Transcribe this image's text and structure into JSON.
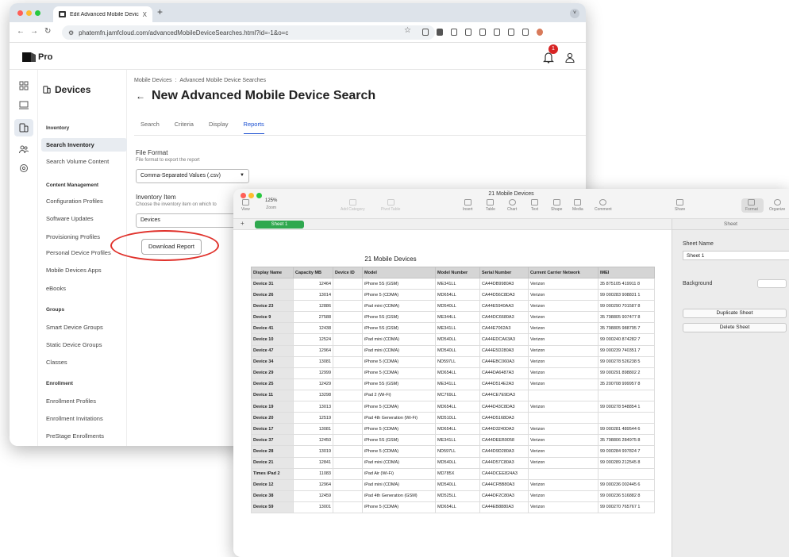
{
  "browser": {
    "tab_title": "Edit Advanced Mobile Devic",
    "tab_close": "X",
    "new_tab": "+",
    "tab_menu": "˅",
    "url": "phatemfn.jamfcloud.com/advancedMobileDeviceSearches.html?id=-1&o=c",
    "traffic_lights": [
      "#ff5f57",
      "#febc2e",
      "#28c840"
    ]
  },
  "app": {
    "logo_text": "Pro",
    "notification_count": "1"
  },
  "sidebar": {
    "title": "Devices",
    "groups": [
      {
        "label": "Inventory",
        "items": [
          {
            "label": "Search Inventory",
            "active": true
          },
          {
            "label": "Search Volume Content",
            "active": false
          }
        ]
      },
      {
        "label": "Content Management",
        "items": [
          {
            "label": "Configuration Profiles",
            "active": false
          },
          {
            "label": "Software Updates",
            "active": false
          },
          {
            "label": "Provisioning Profiles",
            "active": false
          },
          {
            "label": "Personal Device Profiles",
            "active": false
          },
          {
            "label": "Mobile Devices Apps",
            "active": false
          },
          {
            "label": "eBooks",
            "active": false
          }
        ]
      },
      {
        "label": "Groups",
        "items": [
          {
            "label": "Smart Device Groups",
            "active": false
          },
          {
            "label": "Static Device Groups",
            "active": false
          },
          {
            "label": "Classes",
            "active": false
          }
        ]
      },
      {
        "label": "Enrollment",
        "items": [
          {
            "label": "Enrollment Profiles",
            "active": false
          },
          {
            "label": "Enrollment Invitations",
            "active": false
          },
          {
            "label": "PreStage Enrollments",
            "active": false
          }
        ]
      }
    ]
  },
  "page": {
    "breadcrumb": [
      "Mobile Devices",
      "Advanced Mobile Device Searches"
    ],
    "breadcrumb_sep": ":",
    "back_arrow": "←",
    "title": "New Advanced Mobile Device Search",
    "tabs": [
      "Search",
      "Criteria",
      "Display",
      "Reports"
    ],
    "active_tab": "Reports",
    "file_format": {
      "label": "File Format",
      "desc": "File format to export the report",
      "value": "Comma-Separated Values (.csv)"
    },
    "inventory_item": {
      "label": "Inventory Item",
      "desc": "Choose the inventory item on which to",
      "value": "Devices"
    },
    "download_button": "Download Report",
    "annotation_color": "#e0312b"
  },
  "numbers": {
    "window_title": "21 Mobile Devices",
    "toolbar_left": [
      {
        "label": "View",
        "dim": false
      },
      {
        "label": "Zoom",
        "dim": false
      },
      {
        "label": "Add Category",
        "dim": true
      },
      {
        "label": "Pivot Table",
        "dim": true
      }
    ],
    "zoom_value": "125%",
    "toolbar_center": [
      "Insert",
      "Table",
      "Chart",
      "Text",
      "Shape",
      "Media",
      "Comment"
    ],
    "toolbar_right": [
      "Share",
      "Format",
      "Organize"
    ],
    "add_sheet": "+",
    "sheet_tab": "Sheet 1",
    "table_title": "21 Mobile Devices",
    "columns": [
      "Display Name",
      "Capacity MB",
      "Device ID",
      "Model",
      "Model Number",
      "Serial Number",
      "Current Carrier Network",
      "IMEI"
    ],
    "rows": [
      [
        "Device 31",
        "12464",
        "",
        "iPhone 5S (GSM)",
        "ME341LL",
        "CA44DB9980A3",
        "Verizon",
        "35 875105 419911 8"
      ],
      [
        "Device 26",
        "13014",
        "",
        "iPhone 5 (CDMA)",
        "MD654LL",
        "CA44D56C8DA3",
        "Verizon",
        "99 000283 908831 1"
      ],
      [
        "Device 23",
        "12886",
        "",
        "iPad mini (CDMA)",
        "MD540LL",
        "CA44E5940AA3",
        "Verizon",
        "99 000290 701587 8"
      ],
      [
        "Device 9",
        "27588",
        "",
        "iPhone 5S (GSM)",
        "ME344LL",
        "CA44DC6680A3",
        "Verizon",
        "35 798805 907477 8"
      ],
      [
        "Device 41",
        "12438",
        "",
        "iPhone 5S (GSM)",
        "ME341LL",
        "CA44E7062A3",
        "Verizon",
        "35 798805 988795 7"
      ],
      [
        "Device 10",
        "12524",
        "",
        "iPad mini (CDMA)",
        "MD540LL",
        "CA44EDCA63A3",
        "Verizon",
        "99 000240 874282 7"
      ],
      [
        "Device 47",
        "12964",
        "",
        "iPad mini (CDMA)",
        "MD540LL",
        "CA44E5D280A3",
        "Verizon",
        "99 000239 740351 7"
      ],
      [
        "Device 34",
        "13081",
        "",
        "iPhone 5 (CDMA)",
        "ND597LL",
        "CA44EBC060A3",
        "Verizon",
        "99 000278 526238 5"
      ],
      [
        "Device 29",
        "12999",
        "",
        "iPhone 5 (CDMA)",
        "MD654LL",
        "CA44DA6487A3",
        "Verizon",
        "99 000291 898802 2"
      ],
      [
        "Device 25",
        "12429",
        "",
        "iPhone 5S (GSM)",
        "ME341LL",
        "CA44D514E2A3",
        "Verizon",
        "35 200708 999957 8"
      ],
      [
        "Device 11",
        "13298",
        "",
        "iPad 2 (Wi-Fi)",
        "MC769LL",
        "CA44CE7E9DA3",
        "",
        ""
      ],
      [
        "Device 19",
        "13013",
        "",
        "iPhone 5 (CDMA)",
        "MD654LL",
        "CA44D43C8DA3",
        "Verizon",
        "99 000278 548854 1"
      ],
      [
        "Device 20",
        "12519",
        "",
        "iPad 4th Generation (Wi-Fi)",
        "MD510LL",
        "CA44D5168DA3",
        "",
        ""
      ],
      [
        "Device 17",
        "13081",
        "",
        "iPhone 5 (CDMA)",
        "MD654LL",
        "CA44D3240DA3",
        "Verizon",
        "99 000281 489544 6"
      ],
      [
        "Device 37",
        "12450",
        "",
        "iPhone 5S (GSM)",
        "ME341LL",
        "CA44DEEB9058",
        "Verizon",
        "35 798806 284975 8"
      ],
      [
        "Device 28",
        "13019",
        "",
        "iPhone 5 (CDMA)",
        "ND597LL",
        "CA44D9D280A3",
        "Verizon",
        "99 000284 997824 7"
      ],
      [
        "Device 21",
        "12841",
        "",
        "iPad mini (CDMA)",
        "MD540LL",
        "CA44D57C80A3",
        "Verizon",
        "99 000289 212545 8"
      ],
      [
        "Times iPad 2",
        "11083",
        "",
        "iPad Air (Wi-Fi)",
        "MD785X",
        "CA44DCEE824A3",
        "",
        ""
      ],
      [
        "Device 12",
        "12964",
        "",
        "iPad mini (CDMA)",
        "MD540LL",
        "CA44CFBB80A3",
        "Verizon",
        "99 000236 002445 6"
      ],
      [
        "Device 38",
        "12459",
        "",
        "iPad 4th Generation (GSM)",
        "MD525LL",
        "CA44DF2C80A3",
        "Verizon",
        "99 000236 516882 8"
      ],
      [
        "Device 59",
        "13001",
        "",
        "iPhone 5 (CDMA)",
        "MD654LL",
        "CA44EB8880A3",
        "Verizon",
        "99 000270 765767 1"
      ]
    ],
    "inspector": {
      "header": "Sheet",
      "sheet_name_label": "Sheet Name",
      "sheet_name_value": "Sheet 1",
      "background_label": "Background",
      "duplicate_button": "Duplicate Sheet",
      "delete_button": "Delete Sheet"
    },
    "traffic_lights": [
      "#ff5f57",
      "#febc2e",
      "#28c840"
    ]
  }
}
